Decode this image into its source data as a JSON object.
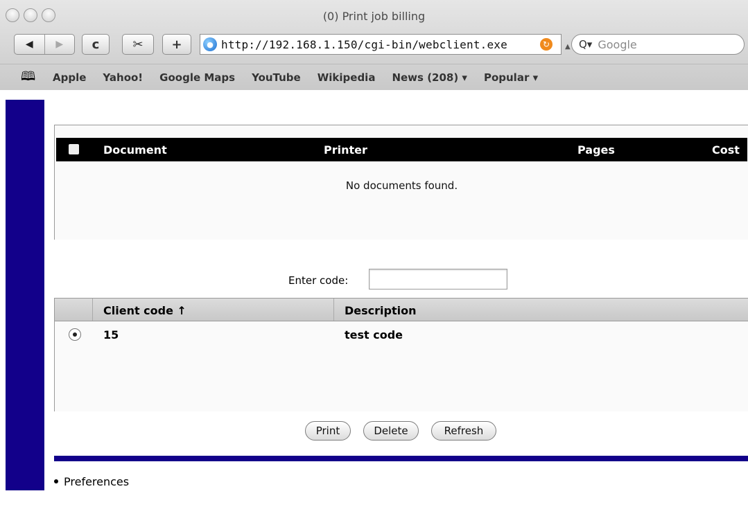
{
  "window": {
    "title": "(0) Print job billing"
  },
  "toolbar": {
    "back_icon": "back-arrow-icon",
    "forward_icon": "forward-arrow-icon",
    "reload_glyph": "c",
    "snap_glyph": "✂",
    "add_glyph": "+",
    "url": "http://192.168.1.150/cgi-bin/webclient.exe",
    "search_placeholder": "Google"
  },
  "bookmarks": [
    "Apple",
    "Yahoo!",
    "Google Maps",
    "YouTube",
    "Wikipedia",
    "News (208) ▾",
    "Popular ▾"
  ],
  "documents": {
    "columns": {
      "document": "Document",
      "printer": "Printer",
      "pages": "Pages",
      "cost": "Cost"
    },
    "empty_message": "No documents found."
  },
  "code_entry": {
    "label": "Enter code:",
    "value": ""
  },
  "clients": {
    "columns": {
      "client_code": "Client code ↑",
      "description": "Description"
    },
    "rows": [
      {
        "code": "15",
        "description": "test code",
        "selected": true
      }
    ]
  },
  "actions": {
    "print": "Print",
    "delete": "Delete",
    "refresh": "Refresh"
  },
  "footer": {
    "preferences_link": "Preferences"
  },
  "colors": {
    "accent_navy": "#12008a",
    "header_black": "#000000"
  }
}
